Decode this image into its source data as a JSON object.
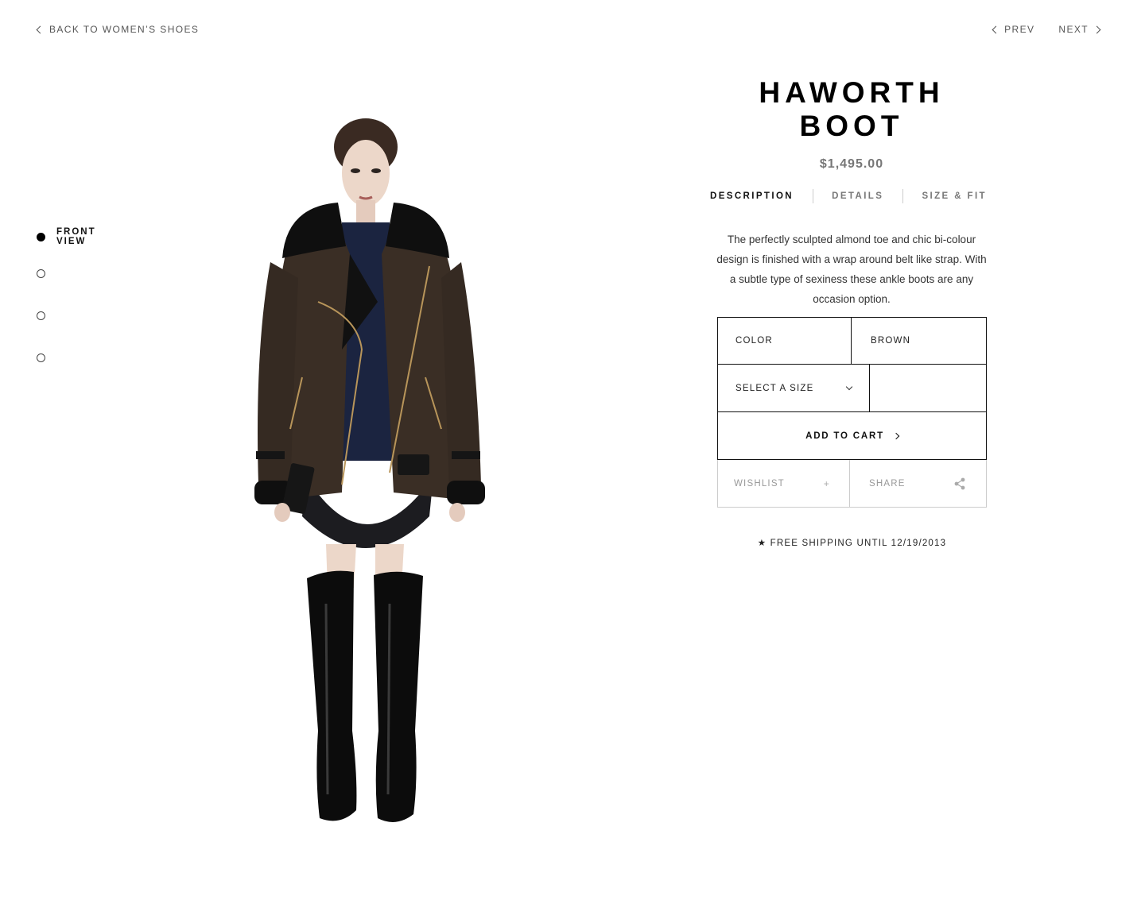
{
  "nav": {
    "back_label": "BACK TO WOMEN’S SHOES",
    "prev_label": "PREV",
    "next_label": "NEXT"
  },
  "views": {
    "active_label": "FRONT VIEW",
    "count": 4
  },
  "product": {
    "title": "HAWORTH BOOT",
    "price": "$1,495.00",
    "tabs": [
      "DESCRIPTION",
      "DETAILS",
      "SIZE & FIT"
    ],
    "active_tab": "DESCRIPTION",
    "description": "The perfectly sculpted almond toe and chic bi-colour design is finished with a wrap around belt like strap. With a subtle type of sexiness these ankle boots are any occasion option."
  },
  "purchase": {
    "color_label": "COLOR",
    "color_value": "BROWN",
    "size_placeholder": "SELECT A SIZE",
    "add_to_cart": "ADD TO CART",
    "wishlist": "WISHLIST",
    "wishlist_icon": "+",
    "share": "SHARE"
  },
  "shipping": {
    "text": "★ FREE SHIPPING UNTIL 12/19/2013"
  },
  "colors": {
    "accent": "#000000",
    "muted": "#777777",
    "border_light": "#cccccc"
  }
}
